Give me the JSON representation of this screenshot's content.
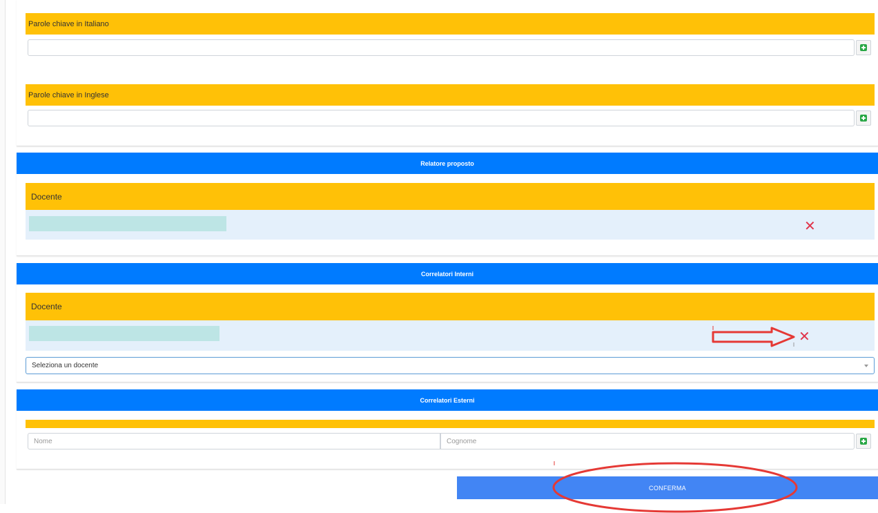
{
  "keywords": {
    "italian": {
      "label": "Parole chiave in Italiano",
      "value": ""
    },
    "english": {
      "label": "Parole chiave in Inglese",
      "value": ""
    }
  },
  "relatore": {
    "section_title": "Relatore proposto",
    "column_header": "Docente",
    "remove_symbol": "✕"
  },
  "correlatori_interni": {
    "section_title": "Correlatori Interni",
    "column_header": "Docente",
    "remove_symbol": "✕",
    "select_selected": "Seleziona un docente"
  },
  "correlatori_esterni": {
    "section_title": "Correlatori Esterni",
    "nome_placeholder": "Nome",
    "cognome_placeholder": "Cognome"
  },
  "actions": {
    "confirm_label": "CONFERMA"
  },
  "colors": {
    "yellow": "#ffc107",
    "blue": "#007bff",
    "confirm_blue": "#4285f4",
    "light_row": "#e4f0fb",
    "teal": "#bde5e5",
    "remove_red": "#e0344a",
    "add_green": "#28a745",
    "annotation_red": "#e53935"
  },
  "icons": {
    "add": "plus-square-icon",
    "remove": "close-icon",
    "select": "caret-down-icon"
  }
}
